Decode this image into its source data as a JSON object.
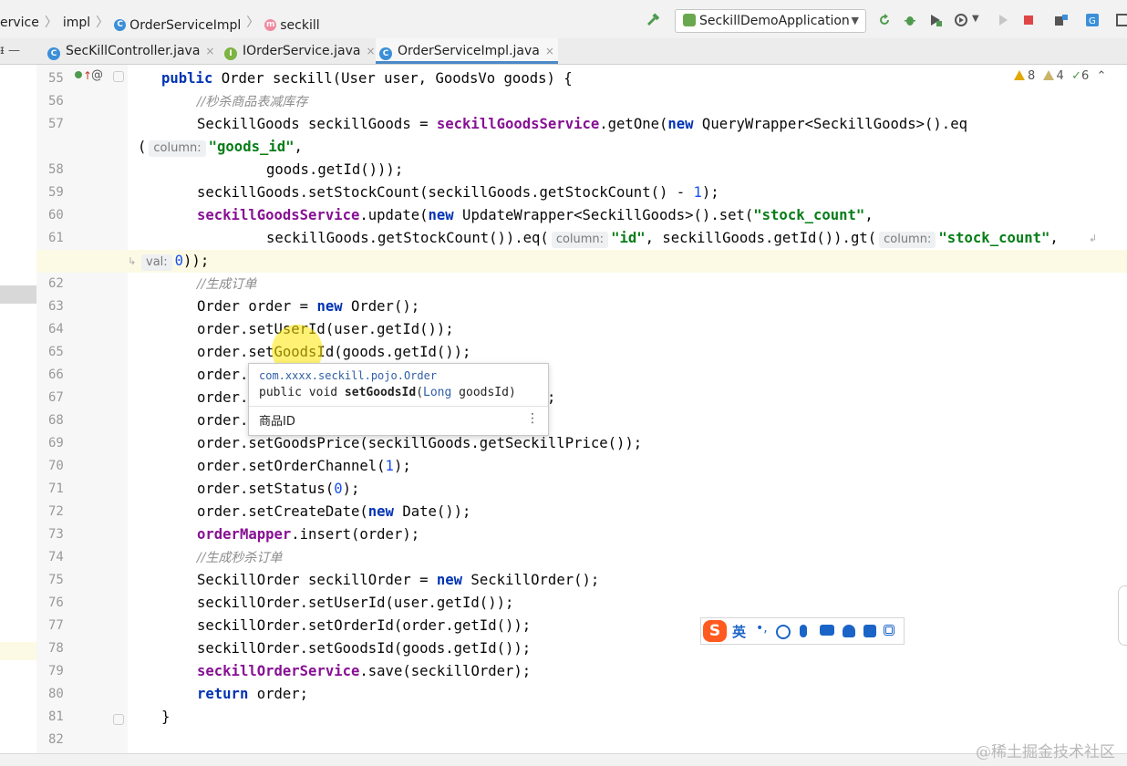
{
  "breadcrumb": {
    "items": [
      "ervice",
      "impl",
      "OrderServiceImpl",
      "seckill"
    ],
    "class_icon": "C",
    "method_icon": "m"
  },
  "toolbar": {
    "run_config": "SeckillDemoApplication",
    "icons": [
      "hammer-icon",
      "refresh-icon",
      "debug-icon",
      "coverage-icon",
      "profile-icon",
      "run-icon",
      "stop-icon",
      "structure-icon",
      "translate-icon"
    ]
  },
  "tabs": [
    {
      "label": "SecKillController.java",
      "icon": "C",
      "icon_color": "#3b8fd8",
      "close": "×"
    },
    {
      "label": "IOrderService.java",
      "icon": "I",
      "icon_color": "#7cb342",
      "close": "×"
    },
    {
      "label": "OrderServiceImpl.java",
      "icon": "C",
      "icon_color": "#3b8fd8",
      "close": "×",
      "active": true
    }
  ],
  "inspections": {
    "warnings": "8",
    "weak_warnings": "4",
    "typos": "6"
  },
  "gutter_marks": {
    "line55": "@"
  },
  "lines": [
    {
      "n": "55"
    },
    {
      "n": "56"
    },
    {
      "n": "57"
    },
    {
      "n": ""
    },
    {
      "n": "58"
    },
    {
      "n": "59"
    },
    {
      "n": "60"
    },
    {
      "n": "61"
    },
    {
      "n": ""
    },
    {
      "n": "62"
    },
    {
      "n": "63"
    },
    {
      "n": "64"
    },
    {
      "n": "65"
    },
    {
      "n": "66"
    },
    {
      "n": "67"
    },
    {
      "n": "68"
    },
    {
      "n": "69"
    },
    {
      "n": "70"
    },
    {
      "n": "71"
    },
    {
      "n": "72"
    },
    {
      "n": "73"
    },
    {
      "n": "74"
    },
    {
      "n": "75"
    },
    {
      "n": "76"
    },
    {
      "n": "77"
    },
    {
      "n": "78"
    },
    {
      "n": "79"
    },
    {
      "n": "80"
    },
    {
      "n": "81"
    },
    {
      "n": "82"
    }
  ],
  "code": {
    "l55_kw": "public",
    "l55_rest": " Order seckill(User user, GoodsVo goods) {",
    "l56": "//秒杀商品表减库存",
    "l57_a": "SeckillGoods seckillGoods = ",
    "l57_fld": "seckillGoodsService",
    "l57_b": ".getOne(",
    "l57_kw": "new",
    "l57_c": " QueryWrapper<SeckillGoods>().eq",
    "l57w_a": "(",
    "l57w_hint": "column:",
    "l57w_str": "\"goods_id\"",
    "l57w_b": ",",
    "l58": "goods.getId()));",
    "l59_a": "seckillGoods.setStockCount(seckillGoods.getStockCount() - ",
    "l59_num": "1",
    "l59_b": ");",
    "l60_fld": "seckillGoodsService",
    "l60_a": ".update(",
    "l60_kw": "new",
    "l60_b": " UpdateWrapper<SeckillGoods>().set(",
    "l60_str": "\"stock_count\"",
    "l60_c": ",",
    "l61_a": "seckillGoods.getStockCount()).eq(",
    "l61_hint1": "column:",
    "l61_str1": "\"id\"",
    "l61_b": ", seckillGoods.getId()).gt(",
    "l61_hint2": "column:",
    "l61_str2": "\"stock_count\"",
    "l61_c": ",",
    "l61w_hint": "val:",
    "l61w_num": "0",
    "l61w_a": "));",
    "l62": "//生成订单",
    "l63_a": "Order order = ",
    "l63_kw": "new",
    "l63_b": " Order();",
    "l64": "order.setUserId(user.getId());",
    "l65": "order.setGoodsId(goods.getId());",
    "l66": "order.",
    "l67": "order.",
    "l67_tail": ";",
    "l68": "order.",
    "l69": "order.setGoodsPrice(seckillGoods.getSeckillPrice());",
    "l70_a": "order.setOrderChannel(",
    "l70_num": "1",
    "l70_b": ");",
    "l71_a": "order.setStatus(",
    "l71_num": "0",
    "l71_b": ");",
    "l72_a": "order.setCreateDate(",
    "l72_kw": "new",
    "l72_b": " Date());",
    "l73_fld": "orderMapper",
    "l73_a": ".insert(order);",
    "l74": "//生成秒杀订单",
    "l75_a": "SeckillOrder seckillOrder = ",
    "l75_kw": "new",
    "l75_b": " SeckillOrder();",
    "l76": "seckillOrder.setUserId(user.getId());",
    "l77": "seckillOrder.setOrderId(order.getId());",
    "l78": "seckillOrder.setGoodsId(goods.getId());",
    "l79_fld": "seckillOrderService",
    "l79_a": ".save(seckillOrder);",
    "l80_kw": "return",
    "l80_a": " order;",
    "l81": "}"
  },
  "popup": {
    "package": "com.xxxx.seckill.pojo.Order",
    "sig_a": "public void ",
    "sig_method": "setGoodsId",
    "sig_b": "(",
    "sig_type": "Long",
    "sig_c": " goodsId)",
    "description": "商品ID",
    "more": "⋮"
  },
  "ime": {
    "logo": "S",
    "lang": "英",
    "icons": [
      "punct-icon",
      "emoji-icon",
      "mic-icon",
      "keyboard-icon",
      "user-icon",
      "skin-icon",
      "grid-icon"
    ]
  },
  "watermark": "@稀土掘金技术社区"
}
